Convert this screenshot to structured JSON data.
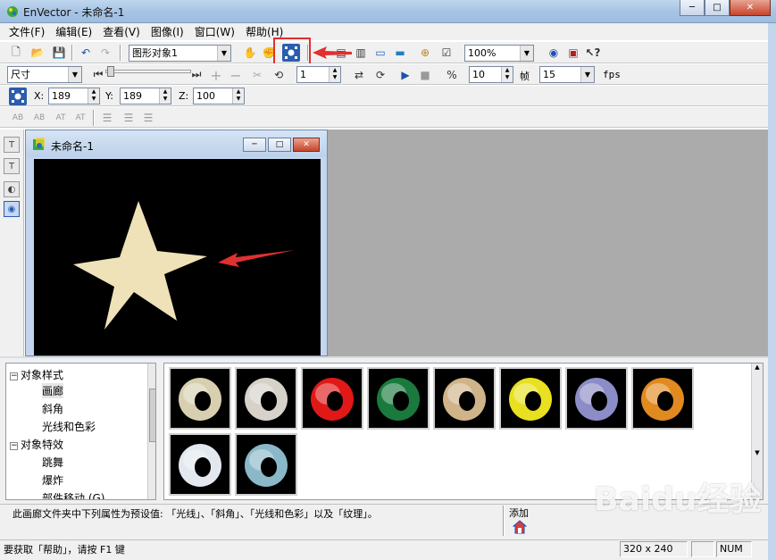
{
  "window": {
    "title": "EnVector - 未命名-1"
  },
  "menu": [
    "文件(F)",
    "编辑(E)",
    "查看(V)",
    "图像(I)",
    "窗口(W)",
    "帮助(H)"
  ],
  "toolbar1": {
    "object_type": "图形对象1",
    "zoom": "100%"
  },
  "toolbar2": {
    "mode": "尺寸",
    "frame_value": "1",
    "frames": "10",
    "frame_label": "帧",
    "fps_value": "15",
    "fps_label": "fps"
  },
  "toolbar3": {
    "x_label": "X:",
    "x_value": "189",
    "y_label": "Y:",
    "y_value": "189",
    "z_label": "Z:",
    "z_value": "100"
  },
  "toolbar4": {
    "text_buttons": [
      "AB",
      "AB",
      "AT",
      "AT"
    ]
  },
  "child": {
    "title": "未命名-1"
  },
  "tree": {
    "items": [
      {
        "label": "对象样式",
        "level": 0,
        "toggle": "-"
      },
      {
        "label": "画廊",
        "level": 1,
        "selected": true
      },
      {
        "label": "斜角",
        "level": 1
      },
      {
        "label": "光线和色彩",
        "level": 1
      },
      {
        "label": "对象特效",
        "level": 0,
        "toggle": "-"
      },
      {
        "label": "跳舞",
        "level": 1
      },
      {
        "label": "爆炸",
        "level": 1
      },
      {
        "label": "部件移动 (G)",
        "level": 1
      }
    ]
  },
  "gallery": {
    "thumbs": [
      {
        "color": "#d8cfb0",
        "name": "ring-cream"
      },
      {
        "color": "#d6d2ca",
        "name": "ring-gray"
      },
      {
        "color": "#e01818",
        "name": "ring-red"
      },
      {
        "color": "#1a7a3e",
        "name": "ring-green"
      },
      {
        "color": "#cfb48a",
        "name": "ring-tan"
      },
      {
        "color": "#e8e020",
        "name": "ring-yellow"
      },
      {
        "color": "#8c8cc6",
        "name": "ring-lavender"
      },
      {
        "color": "#e08a20",
        "name": "ring-orange"
      },
      {
        "color": "#e2e8ee",
        "name": "ring-white"
      },
      {
        "color": "#8ab8c8",
        "name": "ring-blue"
      }
    ]
  },
  "description": "此画廊文件夹中下列属性为预设值: 「光线」、「斜角」、「光线和色彩」以及「纹理」。",
  "add_label": "添加",
  "status": {
    "help": "要获取「帮助」，请按 F1 键",
    "size": "320 x 240",
    "num": "NUM"
  },
  "colors": {
    "star": "#efe2b8",
    "arrow": "#e03030",
    "mdi_bg": "#ababab"
  },
  "watermark": "Baidu经验"
}
